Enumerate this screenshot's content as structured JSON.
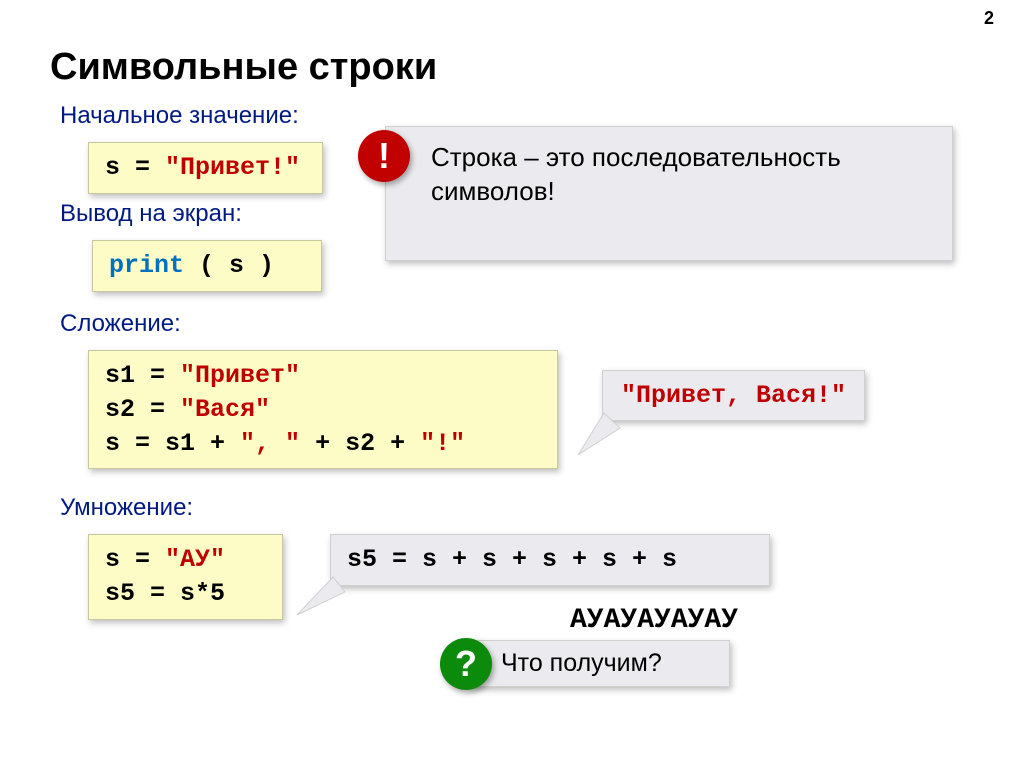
{
  "page_number": "2",
  "title": "Символьные строки",
  "sections": {
    "initial": {
      "heading": "Начальное значение:",
      "code_var": "s",
      "code_eq": " = ",
      "code_str": "\"Привет!\""
    },
    "output": {
      "heading": "Вывод на экран:",
      "code_kw": "print",
      "code_rest": " ( s )"
    },
    "concat": {
      "heading": "Сложение:",
      "line1_a": "s1",
      "line1_b": " = ",
      "line1_c": "\"Привет\"",
      "line2_a": "s2",
      "line2_b": " = ",
      "line2_c": "\"Вася\"",
      "line3_a": "s ",
      "line3_b": " = s1 + ",
      "line3_c": "\", \"",
      "line3_d": " + s2 + ",
      "line3_e": "\"!\""
    },
    "mult": {
      "heading": "Умножение:",
      "line1_a": "s",
      "line1_b": " = ",
      "line1_c": "\"АУ\"",
      "line2": "s5 = s*5"
    }
  },
  "callout_info": {
    "badge": "!",
    "text": "Строка – это последовательность символов!"
  },
  "speech_concat": "\"Привет, Вася!\"",
  "speech_mult_expand": "s5 = s + s + s + s + s",
  "mult_result": "АУАУАУАУАУ",
  "question": {
    "badge": "?",
    "text": "Что получим?"
  }
}
